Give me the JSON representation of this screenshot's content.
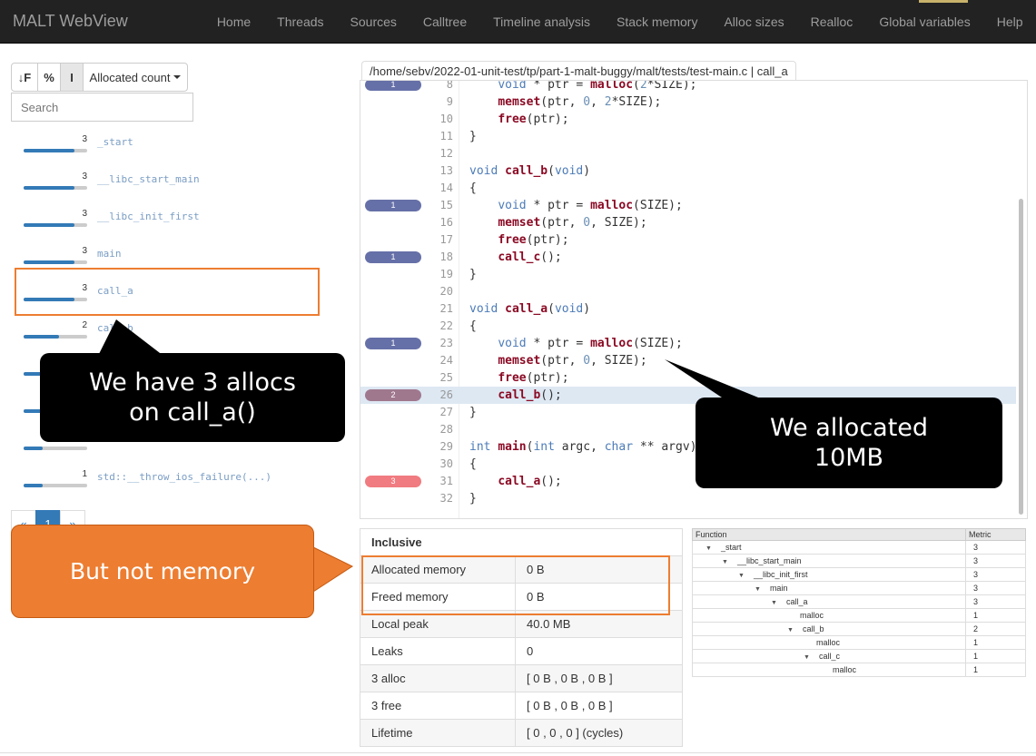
{
  "app": {
    "brand": "MALT WebView"
  },
  "nav": [
    "Home",
    "Threads",
    "Sources",
    "Calltree",
    "Timeline analysis",
    "Stack memory",
    "Alloc sizes",
    "Realloc",
    "Global variables",
    "Help"
  ],
  "toolbar": {
    "sort_label": "↓F",
    "percent_label": "%",
    "inclusive_label": "I",
    "metric_label": "Allocated count"
  },
  "search": {
    "placeholder": "Search"
  },
  "functions": [
    {
      "count": "3",
      "name": "_start",
      "fill": 0.8
    },
    {
      "count": "3",
      "name": "__libc_start_main",
      "fill": 0.8
    },
    {
      "count": "3",
      "name": "__libc_init_first",
      "fill": 0.8
    },
    {
      "count": "3",
      "name": "main",
      "fill": 0.8
    },
    {
      "count": "3",
      "name": "call_a",
      "fill": 0.8
    },
    {
      "count": "2",
      "name": "call_b",
      "fill": 0.55
    },
    {
      "count": "",
      "name": "",
      "fill": 0.35
    },
    {
      "count": "",
      "name": "",
      "fill": 0.35
    },
    {
      "count": "",
      "name": "",
      "fill": 0.3
    },
    {
      "count": "1",
      "name": "std::__throw_ios_failure(...)",
      "fill": 0.3
    }
  ],
  "pager": {
    "prev": "«",
    "current": "1",
    "next": "»"
  },
  "source": {
    "path": "/home/sebv/2022-01-unit-test/tp/part-1-malt-buggy/malt/tests/test-main.c | call_a",
    "lines": [
      {
        "n": "8",
        "badge": "1",
        "color": "#6670a8",
        "code": "    void * ptr = malloc(2*SIZE);"
      },
      {
        "n": "9",
        "badge": "",
        "color": "",
        "code": "    memset(ptr, 0, 2*SIZE);"
      },
      {
        "n": "10",
        "badge": "",
        "color": "",
        "code": "    free(ptr);"
      },
      {
        "n": "11",
        "badge": "",
        "color": "",
        "code": "}"
      },
      {
        "n": "12",
        "badge": "",
        "color": "",
        "code": ""
      },
      {
        "n": "13",
        "badge": "",
        "color": "",
        "code": "void call_b(void)"
      },
      {
        "n": "14",
        "badge": "",
        "color": "",
        "code": "{"
      },
      {
        "n": "15",
        "badge": "1",
        "color": "#6670a8",
        "code": "    void * ptr = malloc(SIZE);"
      },
      {
        "n": "16",
        "badge": "",
        "color": "",
        "code": "    memset(ptr, 0, SIZE);"
      },
      {
        "n": "17",
        "badge": "",
        "color": "",
        "code": "    free(ptr);"
      },
      {
        "n": "18",
        "badge": "1",
        "color": "#6670a8",
        "code": "    call_c();"
      },
      {
        "n": "19",
        "badge": "",
        "color": "",
        "code": "}"
      },
      {
        "n": "20",
        "badge": "",
        "color": "",
        "code": ""
      },
      {
        "n": "21",
        "badge": "",
        "color": "",
        "code": "void call_a(void)"
      },
      {
        "n": "22",
        "badge": "",
        "color": "",
        "code": "{"
      },
      {
        "n": "23",
        "badge": "1",
        "color": "#6670a8",
        "code": "    void * ptr = malloc(SIZE);"
      },
      {
        "n": "24",
        "badge": "",
        "color": "",
        "code": "    memset(ptr, 0, SIZE);"
      },
      {
        "n": "25",
        "badge": "",
        "color": "",
        "code": "    free(ptr);"
      },
      {
        "n": "26",
        "badge": "2",
        "color": "#a0788e",
        "code": "    call_b();",
        "hl": true
      },
      {
        "n": "27",
        "badge": "",
        "color": "",
        "code": "}"
      },
      {
        "n": "28",
        "badge": "",
        "color": "",
        "code": ""
      },
      {
        "n": "29",
        "badge": "",
        "color": "",
        "code": "int main(int argc, char ** argv)"
      },
      {
        "n": "30",
        "badge": "",
        "color": "",
        "code": "{"
      },
      {
        "n": "31",
        "badge": "3",
        "color": "#f07b80",
        "code": "    call_a();"
      },
      {
        "n": "32",
        "badge": "",
        "color": "",
        "code": "}"
      }
    ]
  },
  "inclusive": {
    "title": "Inclusive",
    "rows": [
      {
        "k": "Allocated memory",
        "v": "0 B"
      },
      {
        "k": "Freed memory",
        "v": "0 B"
      },
      {
        "k": "Local peak",
        "v": "40.0 MB"
      },
      {
        "k": "Leaks",
        "v": "0"
      },
      {
        "k": "3 alloc",
        "v": "[ 0 B , 0 B , 0 B ]"
      },
      {
        "k": "3 free",
        "v": "[ 0 B , 0 B , 0 B ]"
      },
      {
        "k": "Lifetime",
        "v": "[ 0 , 0 , 0 ] (cycles)"
      }
    ]
  },
  "calltree": {
    "head_function": "Function",
    "head_metric": "Metric",
    "rows": [
      {
        "name": "_start",
        "depth": 0,
        "arrow": true,
        "m": "3"
      },
      {
        "name": "__libc_start_main",
        "depth": 1,
        "arrow": true,
        "m": "3"
      },
      {
        "name": "__libc_init_first",
        "depth": 2,
        "arrow": true,
        "m": "3"
      },
      {
        "name": "main",
        "depth": 3,
        "arrow": true,
        "m": "3"
      },
      {
        "name": "call_a",
        "depth": 4,
        "arrow": true,
        "m": "3"
      },
      {
        "name": "malloc",
        "depth": 5,
        "arrow": false,
        "m": "1"
      },
      {
        "name": "call_b",
        "depth": 5,
        "arrow": true,
        "m": "2"
      },
      {
        "name": "malloc",
        "depth": 6,
        "arrow": false,
        "m": "1"
      },
      {
        "name": "call_c",
        "depth": 6,
        "arrow": true,
        "m": "1"
      },
      {
        "name": "malloc",
        "depth": 7,
        "arrow": false,
        "m": "1"
      }
    ]
  },
  "callouts": {
    "allocs": [
      "We have 3 allocs",
      "on call_a()"
    ],
    "allocated": [
      "We allocated",
      "10MB"
    ],
    "memory": "But not memory"
  },
  "colors": {
    "navbar": "#222222",
    "accent_orange": "#ed7d31",
    "bar_blue": "#337ab7"
  }
}
